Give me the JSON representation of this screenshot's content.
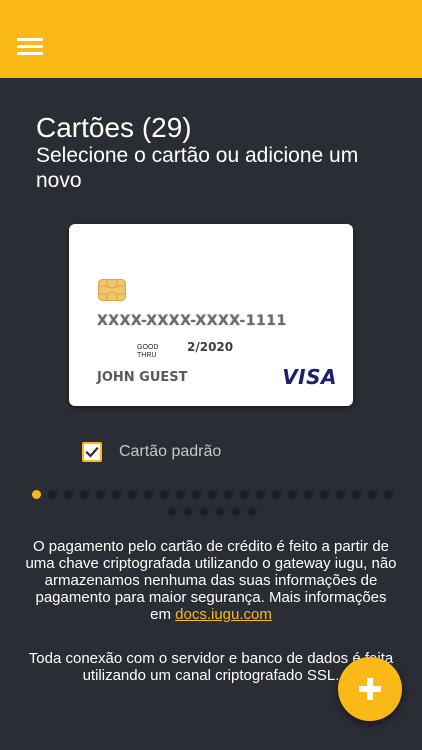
{
  "appbar": {
    "color": "#fbb918",
    "menu_icon": "menu-icon"
  },
  "header": {
    "title": "Cartões (29)",
    "subtitle": "Selecione o cartão ou adicione um novo"
  },
  "card": {
    "number": "XXXX-XXXX-XXXX-1111",
    "good_thru_label": "GOOD THRU",
    "expiry": "2/2020",
    "holder": "JOHN GUEST",
    "brand": "VISA",
    "chip_icon": "chip-icon"
  },
  "default_card": {
    "label": "Cartão padrão",
    "checked": true
  },
  "pager": {
    "total": 29,
    "active_index": 0
  },
  "info": {
    "text": "O pagamento pelo cartão de crédito é feito a partir de uma chave criptografada utilizando o gateway iugu, não armazenamos nenhuma das suas informações de pagamento para maior segurança. Mais informações em ",
    "link": "docs.iugu.com",
    "text2": "Toda conexão com o servidor e banco de dados é feita utilizando um canal criptografado SSL."
  },
  "fab": {
    "icon": "plus-icon"
  },
  "colors": {
    "accent": "#fbb918",
    "background": "#2a2d33",
    "visa_blue": "#1a1f71"
  }
}
